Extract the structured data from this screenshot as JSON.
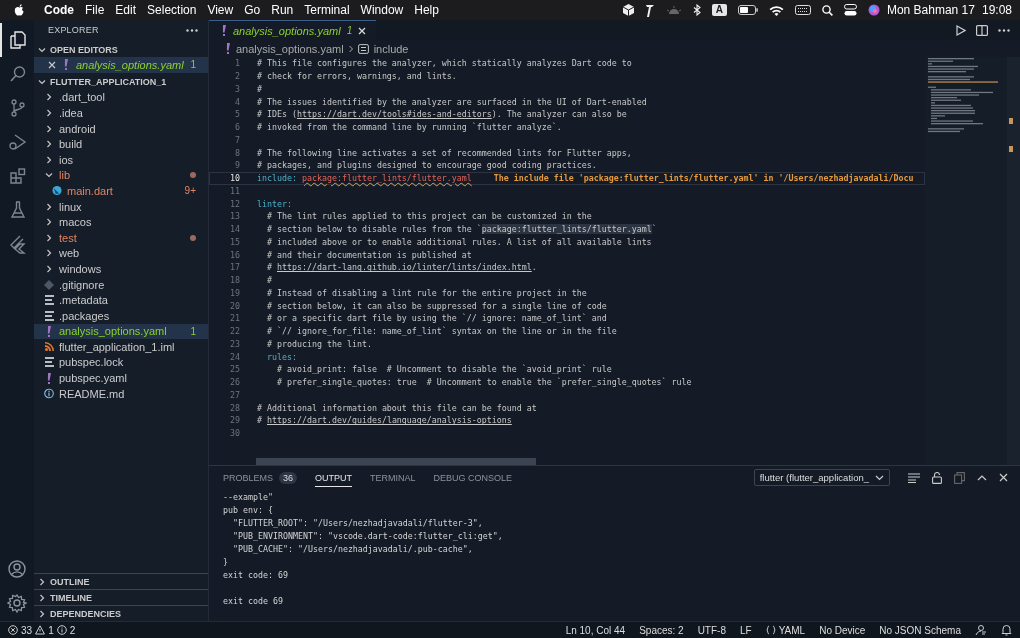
{
  "menubar": {
    "app": "Code",
    "menus": [
      "File",
      "Edit",
      "Selection",
      "View",
      "Go",
      "Run",
      "Terminal",
      "Window",
      "Help"
    ],
    "input_source": "A",
    "date": "Mon Bahman 17",
    "time": "19:08"
  },
  "activity_bar": {
    "items": [
      {
        "kind": "files",
        "selected": true
      },
      {
        "kind": "search",
        "selected": false
      },
      {
        "kind": "source-control",
        "selected": false
      },
      {
        "kind": "run",
        "selected": false
      },
      {
        "kind": "extensions",
        "selected": false
      },
      {
        "kind": "testing",
        "selected": false
      },
      {
        "kind": "flutter",
        "selected": false
      }
    ]
  },
  "sidebar": {
    "title": "EXPLORER",
    "open_editors": {
      "title": "OPEN EDITORS",
      "expanded": true,
      "items": [
        {
          "label": "analysis_options.yaml",
          "kind": "yaml",
          "error": false,
          "warning": true,
          "badge": "1",
          "selected": true
        }
      ]
    },
    "project": {
      "title": "FLUTTER_APPLICATION_1",
      "expanded": true,
      "items": [
        {
          "label": ".dart_tool",
          "kind": "folder",
          "expanded": false,
          "error": false,
          "warning": false,
          "dot": false,
          "selected": false
        },
        {
          "label": ".idea",
          "kind": "folder",
          "expanded": false,
          "error": false,
          "warning": false,
          "dot": false,
          "selected": false
        },
        {
          "label": "android",
          "kind": "folder",
          "expanded": false,
          "error": false,
          "warning": false,
          "dot": false,
          "selected": false
        },
        {
          "label": "build",
          "kind": "folder",
          "expanded": false,
          "error": false,
          "warning": false,
          "dot": false,
          "selected": false
        },
        {
          "label": "ios",
          "kind": "folder",
          "expanded": false,
          "error": false,
          "warning": false,
          "dot": false,
          "selected": false
        },
        {
          "label": "lib",
          "kind": "folder",
          "expanded": true,
          "error": true,
          "warning": false,
          "dot": true,
          "selected": false,
          "children": [
            {
              "label": "main.dart",
              "kind": "dart",
              "error": true,
              "warning": false,
              "badge": "9+",
              "dot": false,
              "selected": false
            }
          ]
        },
        {
          "label": "linux",
          "kind": "folder",
          "expanded": false,
          "error": false,
          "warning": false,
          "dot": false,
          "selected": false
        },
        {
          "label": "macos",
          "kind": "folder",
          "expanded": false,
          "error": false,
          "warning": false,
          "dot": false,
          "selected": false
        },
        {
          "label": "test",
          "kind": "folder",
          "expanded": false,
          "error": true,
          "warning": false,
          "dot": true,
          "selected": false
        },
        {
          "label": "web",
          "kind": "folder",
          "expanded": false,
          "error": false,
          "warning": false,
          "dot": false,
          "selected": false
        },
        {
          "label": "windows",
          "kind": "folder",
          "expanded": false,
          "error": false,
          "warning": false,
          "dot": false,
          "selected": false
        },
        {
          "label": ".gitignore",
          "kind": "git",
          "error": false,
          "warning": false,
          "dot": false,
          "selected": false
        },
        {
          "label": ".metadata",
          "kind": "lines",
          "error": false,
          "warning": false,
          "dot": false,
          "selected": false
        },
        {
          "label": ".packages",
          "kind": "lines",
          "error": false,
          "warning": false,
          "dot": false,
          "selected": false
        },
        {
          "label": "analysis_options.yaml",
          "kind": "yaml",
          "error": false,
          "warning": true,
          "badge": "1",
          "dot": false,
          "selected": true
        },
        {
          "label": "flutter_application_1.iml",
          "kind": "feed",
          "error": false,
          "warning": false,
          "dot": false,
          "selected": false
        },
        {
          "label": "pubspec.lock",
          "kind": "lines",
          "error": false,
          "warning": false,
          "dot": false,
          "selected": false
        },
        {
          "label": "pubspec.yaml",
          "kind": "yaml",
          "error": false,
          "warning": false,
          "dot": false,
          "selected": false
        },
        {
          "label": "README.md",
          "kind": "info",
          "error": false,
          "warning": false,
          "dot": false,
          "selected": false
        }
      ]
    },
    "sections": [
      {
        "title": "OUTLINE",
        "expanded": false
      },
      {
        "title": "TIMELINE",
        "expanded": false
      },
      {
        "title": "DEPENDENCIES",
        "expanded": false
      }
    ]
  },
  "editor": {
    "tabs": [
      {
        "label": "analysis_options.yaml",
        "kind": "yaml",
        "badge": "1",
        "error": false,
        "warning": true,
        "selected": true
      }
    ],
    "breadcrumbs": [
      {
        "label": "analysis_options.yaml",
        "kind": "yaml"
      },
      {
        "label": "include",
        "kind": "symbol"
      }
    ],
    "lines": [
      {
        "number": "1",
        "current": false,
        "segments": [
          {
            "kind": "comment",
            "text": "# This file configures the analyzer, which statically analyzes Dart code to"
          }
        ]
      },
      {
        "number": "2",
        "current": false,
        "segments": [
          {
            "kind": "comment",
            "text": "# check for errors, warnings, and lints."
          }
        ]
      },
      {
        "number": "3",
        "current": false,
        "segments": [
          {
            "kind": "comment",
            "text": "#"
          }
        ]
      },
      {
        "number": "4",
        "current": false,
        "segments": [
          {
            "kind": "comment",
            "text": "# The issues identified by the analyzer are surfaced in the UI of Dart-enabled"
          }
        ]
      },
      {
        "number": "5",
        "current": false,
        "segments": [
          {
            "kind": "comment",
            "text": "# IDEs ("
          },
          {
            "kind": "link",
            "text": "https://dart.dev/tools#ides-and-editors"
          },
          {
            "kind": "comment",
            "text": "). The analyzer can also be"
          }
        ]
      },
      {
        "number": "6",
        "current": false,
        "segments": [
          {
            "kind": "comment",
            "text": "# invoked from the command line by running `flutter analyze`."
          }
        ]
      },
      {
        "number": "7",
        "current": false
      },
      {
        "number": "8",
        "current": false,
        "segments": [
          {
            "kind": "comment",
            "text": "# The following line activates a set of recommended lints for Flutter apps,"
          }
        ]
      },
      {
        "number": "9",
        "current": false,
        "segments": [
          {
            "kind": "comment",
            "text": "# packages, and plugins designed to encourage good coding practices."
          }
        ]
      },
      {
        "number": "10",
        "current": true,
        "segments": [
          {
            "kind": "key",
            "text": "include:"
          },
          {
            "kind": "error",
            "text": "package:flutter_lints/flutter.yaml"
          },
          {
            "kind": "hint",
            "text": "The include file 'package:flutter_lints/flutter.yaml' in '/Users/nezhadjavadali/Docu"
          }
        ]
      },
      {
        "number": "11",
        "current": false
      },
      {
        "number": "12",
        "current": false,
        "segments": [
          {
            "kind": "key",
            "text": "linter:"
          }
        ]
      },
      {
        "number": "13",
        "current": false,
        "segments": [
          {
            "kind": "comment",
            "text": "  # The lint rules applied to this project can be customized in the"
          }
        ]
      },
      {
        "number": "14",
        "current": false,
        "segments": [
          {
            "kind": "comment",
            "text": "  # section below to disable rules from the `"
          },
          {
            "kind": "inline_code",
            "text": "package:flutter_lints/flutter.yaml"
          },
          {
            "kind": "comment",
            "text": "`"
          }
        ]
      },
      {
        "number": "15",
        "current": false,
        "segments": [
          {
            "kind": "comment",
            "text": "  # included above or to enable additional rules. A list of all available lints"
          }
        ]
      },
      {
        "number": "16",
        "current": false,
        "segments": [
          {
            "kind": "comment",
            "text": "  # and their documentation is published at"
          }
        ]
      },
      {
        "number": "17",
        "current": false,
        "segments": [
          {
            "kind": "comment",
            "text": "  # "
          },
          {
            "kind": "link",
            "text": "https://dart-lang.github.io/linter/lints/index.html"
          },
          {
            "kind": "comment",
            "text": "."
          }
        ]
      },
      {
        "number": "18",
        "current": false,
        "segments": [
          {
            "kind": "comment",
            "text": "  #"
          }
        ]
      },
      {
        "number": "19",
        "current": false,
        "segments": [
          {
            "kind": "comment",
            "text": "  # Instead of disabling a lint rule for the entire project in the"
          }
        ]
      },
      {
        "number": "20",
        "current": false,
        "segments": [
          {
            "kind": "comment",
            "text": "  # section below, it can also be suppressed for a single line of code"
          }
        ]
      },
      {
        "number": "21",
        "current": false,
        "segments": [
          {
            "kind": "comment",
            "text": "  # or a specific dart file by using the `// ignore: name_of_lint` and"
          }
        ]
      },
      {
        "number": "22",
        "current": false,
        "segments": [
          {
            "kind": "comment",
            "text": "  # `// ignore_for_file: name_of_lint` syntax on the line or in the file"
          }
        ]
      },
      {
        "number": "23",
        "current": false,
        "segments": [
          {
            "kind": "comment",
            "text": "  # producing the lint."
          }
        ]
      },
      {
        "number": "24",
        "current": false,
        "segments": [
          {
            "kind": "key",
            "text": "  rules:"
          }
        ]
      },
      {
        "number": "25",
        "current": false,
        "segments": [
          {
            "kind": "comment",
            "text": "    # avoid_print: false  # Uncomment to disable the `avoid_print` rule"
          }
        ]
      },
      {
        "number": "26",
        "current": false,
        "segments": [
          {
            "kind": "comment",
            "text": "    # prefer_single_quotes: true  # Uncomment to enable the `prefer_single_quotes` rule"
          }
        ]
      },
      {
        "number": "27",
        "current": false
      },
      {
        "number": "28",
        "current": false,
        "segments": [
          {
            "kind": "comment",
            "text": "# Additional information about this file can be found at"
          }
        ]
      },
      {
        "number": "29",
        "current": false,
        "segments": [
          {
            "kind": "comment",
            "text": "# "
          },
          {
            "kind": "link",
            "text": "https://dart.dev/guides/language/analysis-options"
          }
        ]
      },
      {
        "number": "30",
        "current": false
      }
    ]
  },
  "panel": {
    "tabs": [
      {
        "label": "PROBLEMS",
        "badge": "36",
        "selected": false
      },
      {
        "label": "OUTPUT",
        "selected": true
      },
      {
        "label": "TERMINAL",
        "selected": false
      },
      {
        "label": "DEBUG CONSOLE",
        "selected": false
      }
    ],
    "channel": "flutter (flutter_application_",
    "output": [
      {
        "kind": "text",
        "text": "--example\""
      },
      {
        "kind": "text",
        "text": "pub env: {"
      },
      {
        "kind": "text",
        "text": "  \"FLUTTER_ROOT\": \"/Users/nezhadjavadali/flutter-3\","
      },
      {
        "kind": "text",
        "text": "  \"PUB_ENVIRONMENT\": \"vscode.dart-code:flutter_cli:get\","
      },
      {
        "kind": "text",
        "text": "  \"PUB_CACHE\": \"/Users/nezhadjavadali/.pub-cache\","
      },
      {
        "kind": "text",
        "text": "}"
      },
      {
        "kind": "text",
        "text": "exit code: 69"
      },
      {
        "kind": "blank"
      },
      {
        "kind": "text",
        "text": "exit code 69"
      }
    ]
  },
  "status_bar": {
    "errors": "33",
    "warnings": "1",
    "infos": "2",
    "items": [
      {
        "kind": "text",
        "text": "Ln 10, Col 44"
      },
      {
        "kind": "text",
        "text": "Spaces: 2"
      },
      {
        "kind": "text",
        "text": "UTF-8"
      },
      {
        "kind": "text",
        "text": "LF"
      },
      {
        "kind": "language",
        "text": "YAML"
      },
      {
        "kind": "text",
        "text": "No Device"
      },
      {
        "kind": "text",
        "text": "No JSON Schema"
      }
    ]
  }
}
